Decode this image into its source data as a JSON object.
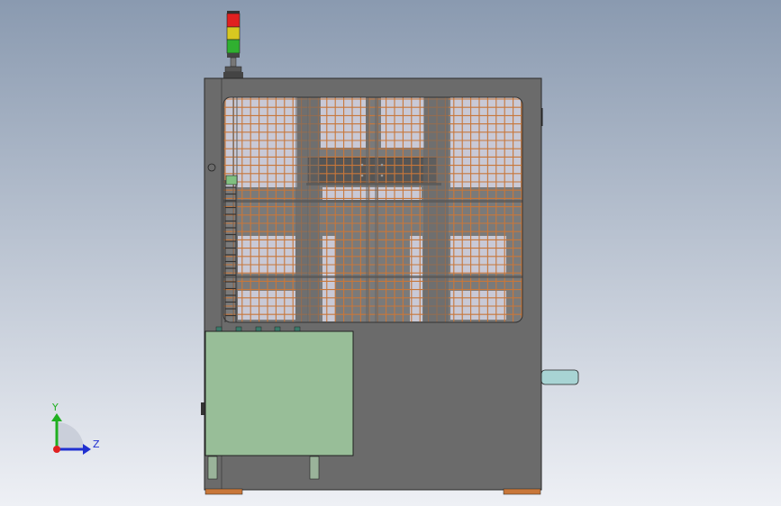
{
  "viewport": {
    "background_top": "#8a9ab0",
    "background_bottom": "#eef0f5"
  },
  "machine": {
    "frame_color": "#6b6b6b",
    "frame_edge": "#2a2a2a",
    "mesh_color": "#c8773a",
    "window_color": "#c9c9d6",
    "cabinet_color": "#98be98",
    "shaft_color": "#a8d4d4",
    "crossbar_color": "#555555",
    "foot_color": "#c8773a"
  },
  "signal_tower": {
    "lights": [
      "red",
      "yellow",
      "green"
    ],
    "colors": [
      "#e02020",
      "#d8c820",
      "#30b030"
    ]
  },
  "triad": {
    "x_color": "#e02020",
    "y_color": "#20b020",
    "z_color": "#2030d0",
    "y_label": "Y",
    "z_label": "Z"
  }
}
